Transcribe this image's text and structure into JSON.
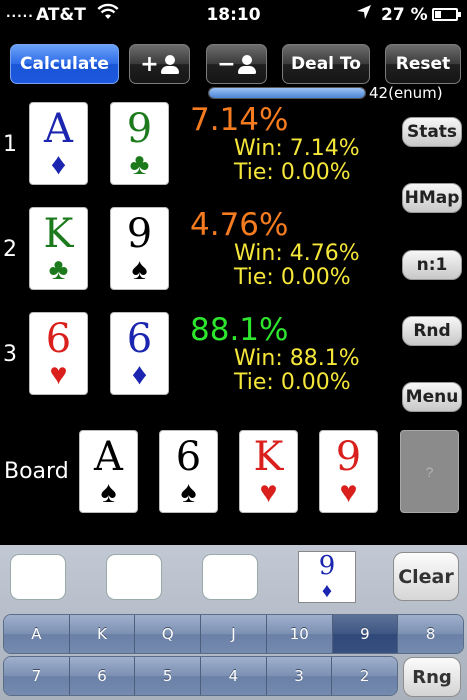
{
  "status_bar": {
    "carrier": "AT&T",
    "time": "18:10",
    "battery": "27 %",
    "battery_level_percent": 27
  },
  "toolbar": {
    "calculate_label": "Calculate",
    "deal_to_label": "Deal To",
    "reset_label": "Reset"
  },
  "progress": {
    "fraction": 1.0,
    "label": "42(enum)"
  },
  "players": [
    {
      "number": "1",
      "cards": [
        {
          "rank": "A",
          "suit": "♦",
          "color": "#1b25b0"
        },
        {
          "rank": "9",
          "suit": "♣",
          "color": "#1c7a1c"
        }
      ],
      "equity": "7.14%",
      "equity_color": "#f47b20",
      "win": "Win: 7.14%",
      "tie": "Tie: 0.00%"
    },
    {
      "number": "2",
      "cards": [
        {
          "rank": "K",
          "suit": "♣",
          "color": "#1c7a1c"
        },
        {
          "rank": "9",
          "suit": "♠",
          "color": "#000000"
        }
      ],
      "equity": "4.76%",
      "equity_color": "#f47b20",
      "win": "Win: 4.76%",
      "tie": "Tie: 0.00%"
    },
    {
      "number": "3",
      "cards": [
        {
          "rank": "6",
          "suit": "♥",
          "color": "#d9201c"
        },
        {
          "rank": "6",
          "suit": "♦",
          "color": "#1b25b0"
        }
      ],
      "equity": "88.1%",
      "equity_color": "#2ee62e",
      "win": "Win: 88.1%",
      "tie": "Tie: 0.00%"
    }
  ],
  "side_buttons": {
    "stats": "Stats",
    "hmap": "HMap",
    "ratio": "n:1",
    "rnd": "Rnd",
    "menu": "Menu"
  },
  "board": {
    "label": "Board",
    "cards": [
      {
        "rank": "A",
        "suit": "♠",
        "color": "#000000"
      },
      {
        "rank": "6",
        "suit": "♠",
        "color": "#000000"
      },
      {
        "rank": "K",
        "suit": "♥",
        "color": "#d9201c"
      },
      {
        "rank": "9",
        "suit": "♥",
        "color": "#d9201c"
      }
    ],
    "empty_slot": "?"
  },
  "tray": {
    "selected_card": {
      "rank": "9",
      "suit": "♦",
      "color": "#1b25b0"
    },
    "clear_label": "Clear",
    "rng_label": "Rng",
    "ranks_row1": [
      "A",
      "K",
      "Q",
      "J",
      "10",
      "9",
      "8"
    ],
    "ranks_row2": [
      "7",
      "6",
      "5",
      "4",
      "3",
      "2"
    ],
    "selected_rank": "9"
  }
}
